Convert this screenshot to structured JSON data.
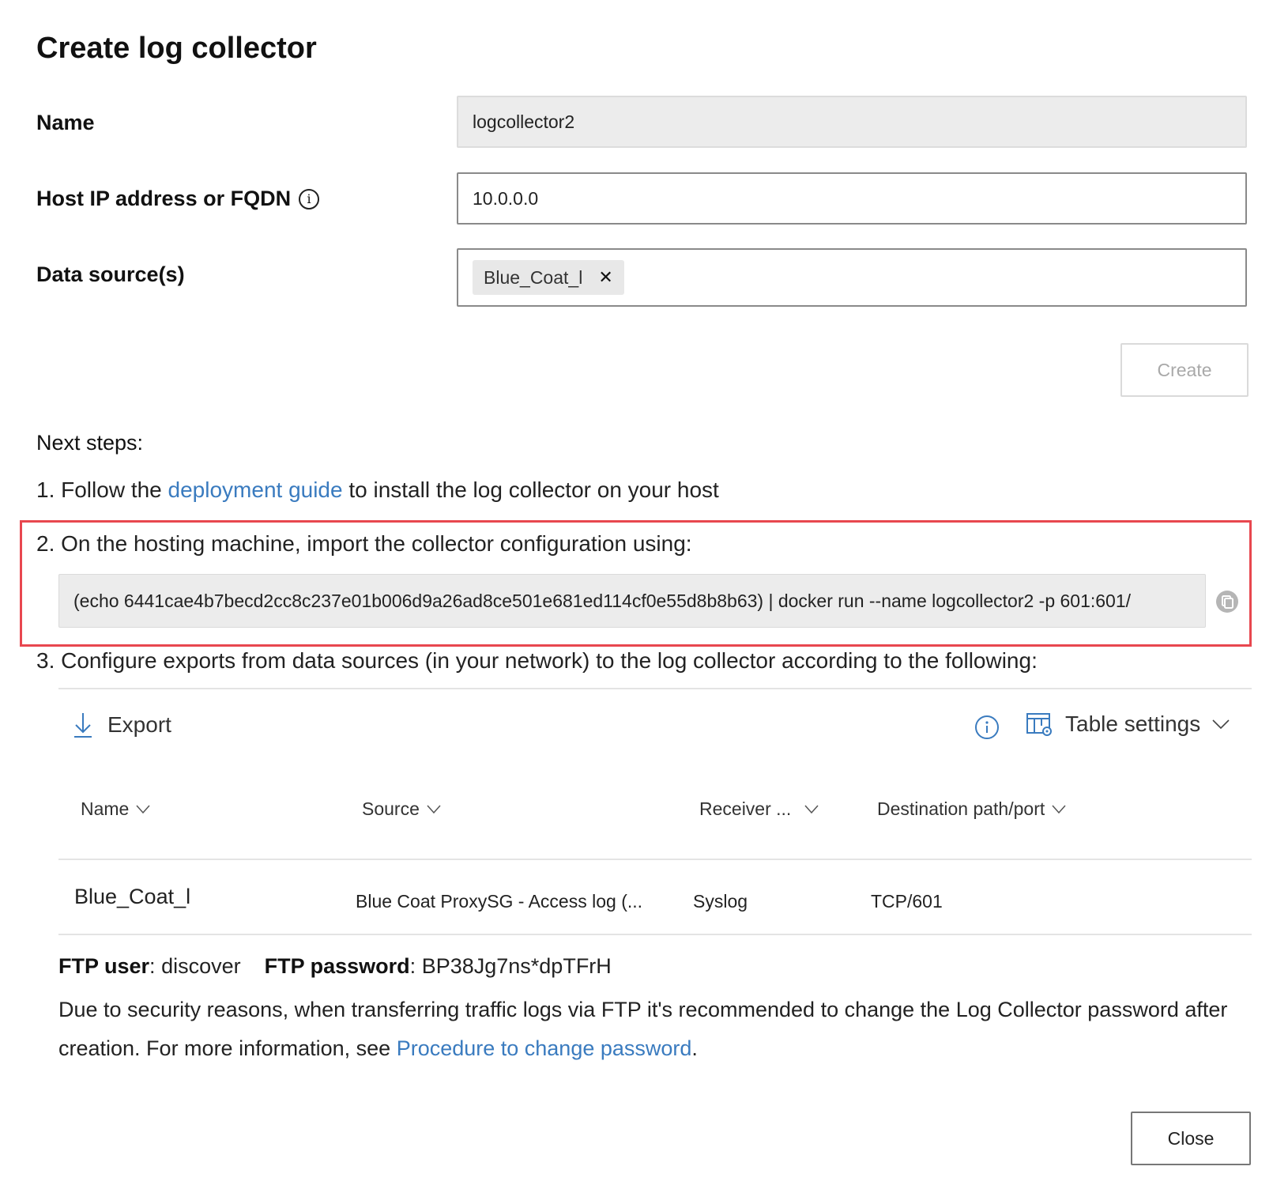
{
  "dialog": {
    "title": "Create log collector"
  },
  "form": {
    "name": {
      "label": "Name",
      "value": "logcollector2"
    },
    "host": {
      "label": "Host IP address or FQDN",
      "info_icon": "info-icon",
      "value": "10.0.0.0"
    },
    "data_sources": {
      "label": "Data source(s)",
      "chips": [
        {
          "label": "Blue_Coat_l",
          "remove_icon": "close-icon"
        }
      ]
    },
    "create_button": "Create"
  },
  "next_steps": {
    "heading": "Next steps:",
    "step1": {
      "prefix": "1. Follow the ",
      "link": "deployment guide",
      "suffix": " to install the log collector on your host"
    },
    "step2": {
      "text": "2. On the hosting machine, import the collector configuration using:",
      "command": "(echo 6441cae4b7becd2cc8c237e01b006d9a26ad8ce501e681ed114cf0e55d8b8b63) | docker run --name logcollector2 -p 601:601/",
      "copy_icon": "copy-icon"
    },
    "step3": {
      "text": "3. Configure exports from data sources (in your network) to the log collector according to the following:"
    }
  },
  "table": {
    "toolbar": {
      "export_label": "Export",
      "export_icon": "download-icon",
      "info_icon": "info-icon",
      "settings_label": "Table settings",
      "settings_icon": "table-settings-icon"
    },
    "columns": [
      "Name",
      "Source",
      "Receiver ...",
      "Destination path/port"
    ],
    "rows": [
      {
        "name": "Blue_Coat_l",
        "source": "Blue Coat ProxySG - Access log (...",
        "receiver": "Syslog",
        "destination": "TCP/601"
      }
    ]
  },
  "ftp": {
    "user_label": "FTP user",
    "user_value": "discover",
    "password_label": "FTP password",
    "password_value": "BP38Jg7ns*dpTFrH",
    "note_text": "Due to security reasons, when transferring traffic logs via FTP it's recommended to change the Log Collector password after creation. For more information, see ",
    "note_link": "Procedure to change password",
    "note_end": "."
  },
  "footer": {
    "close_button": "Close"
  },
  "colors": {
    "link": "#3a7bbf",
    "highlight_border": "#e8474f",
    "disabled_field": "#ececec"
  }
}
